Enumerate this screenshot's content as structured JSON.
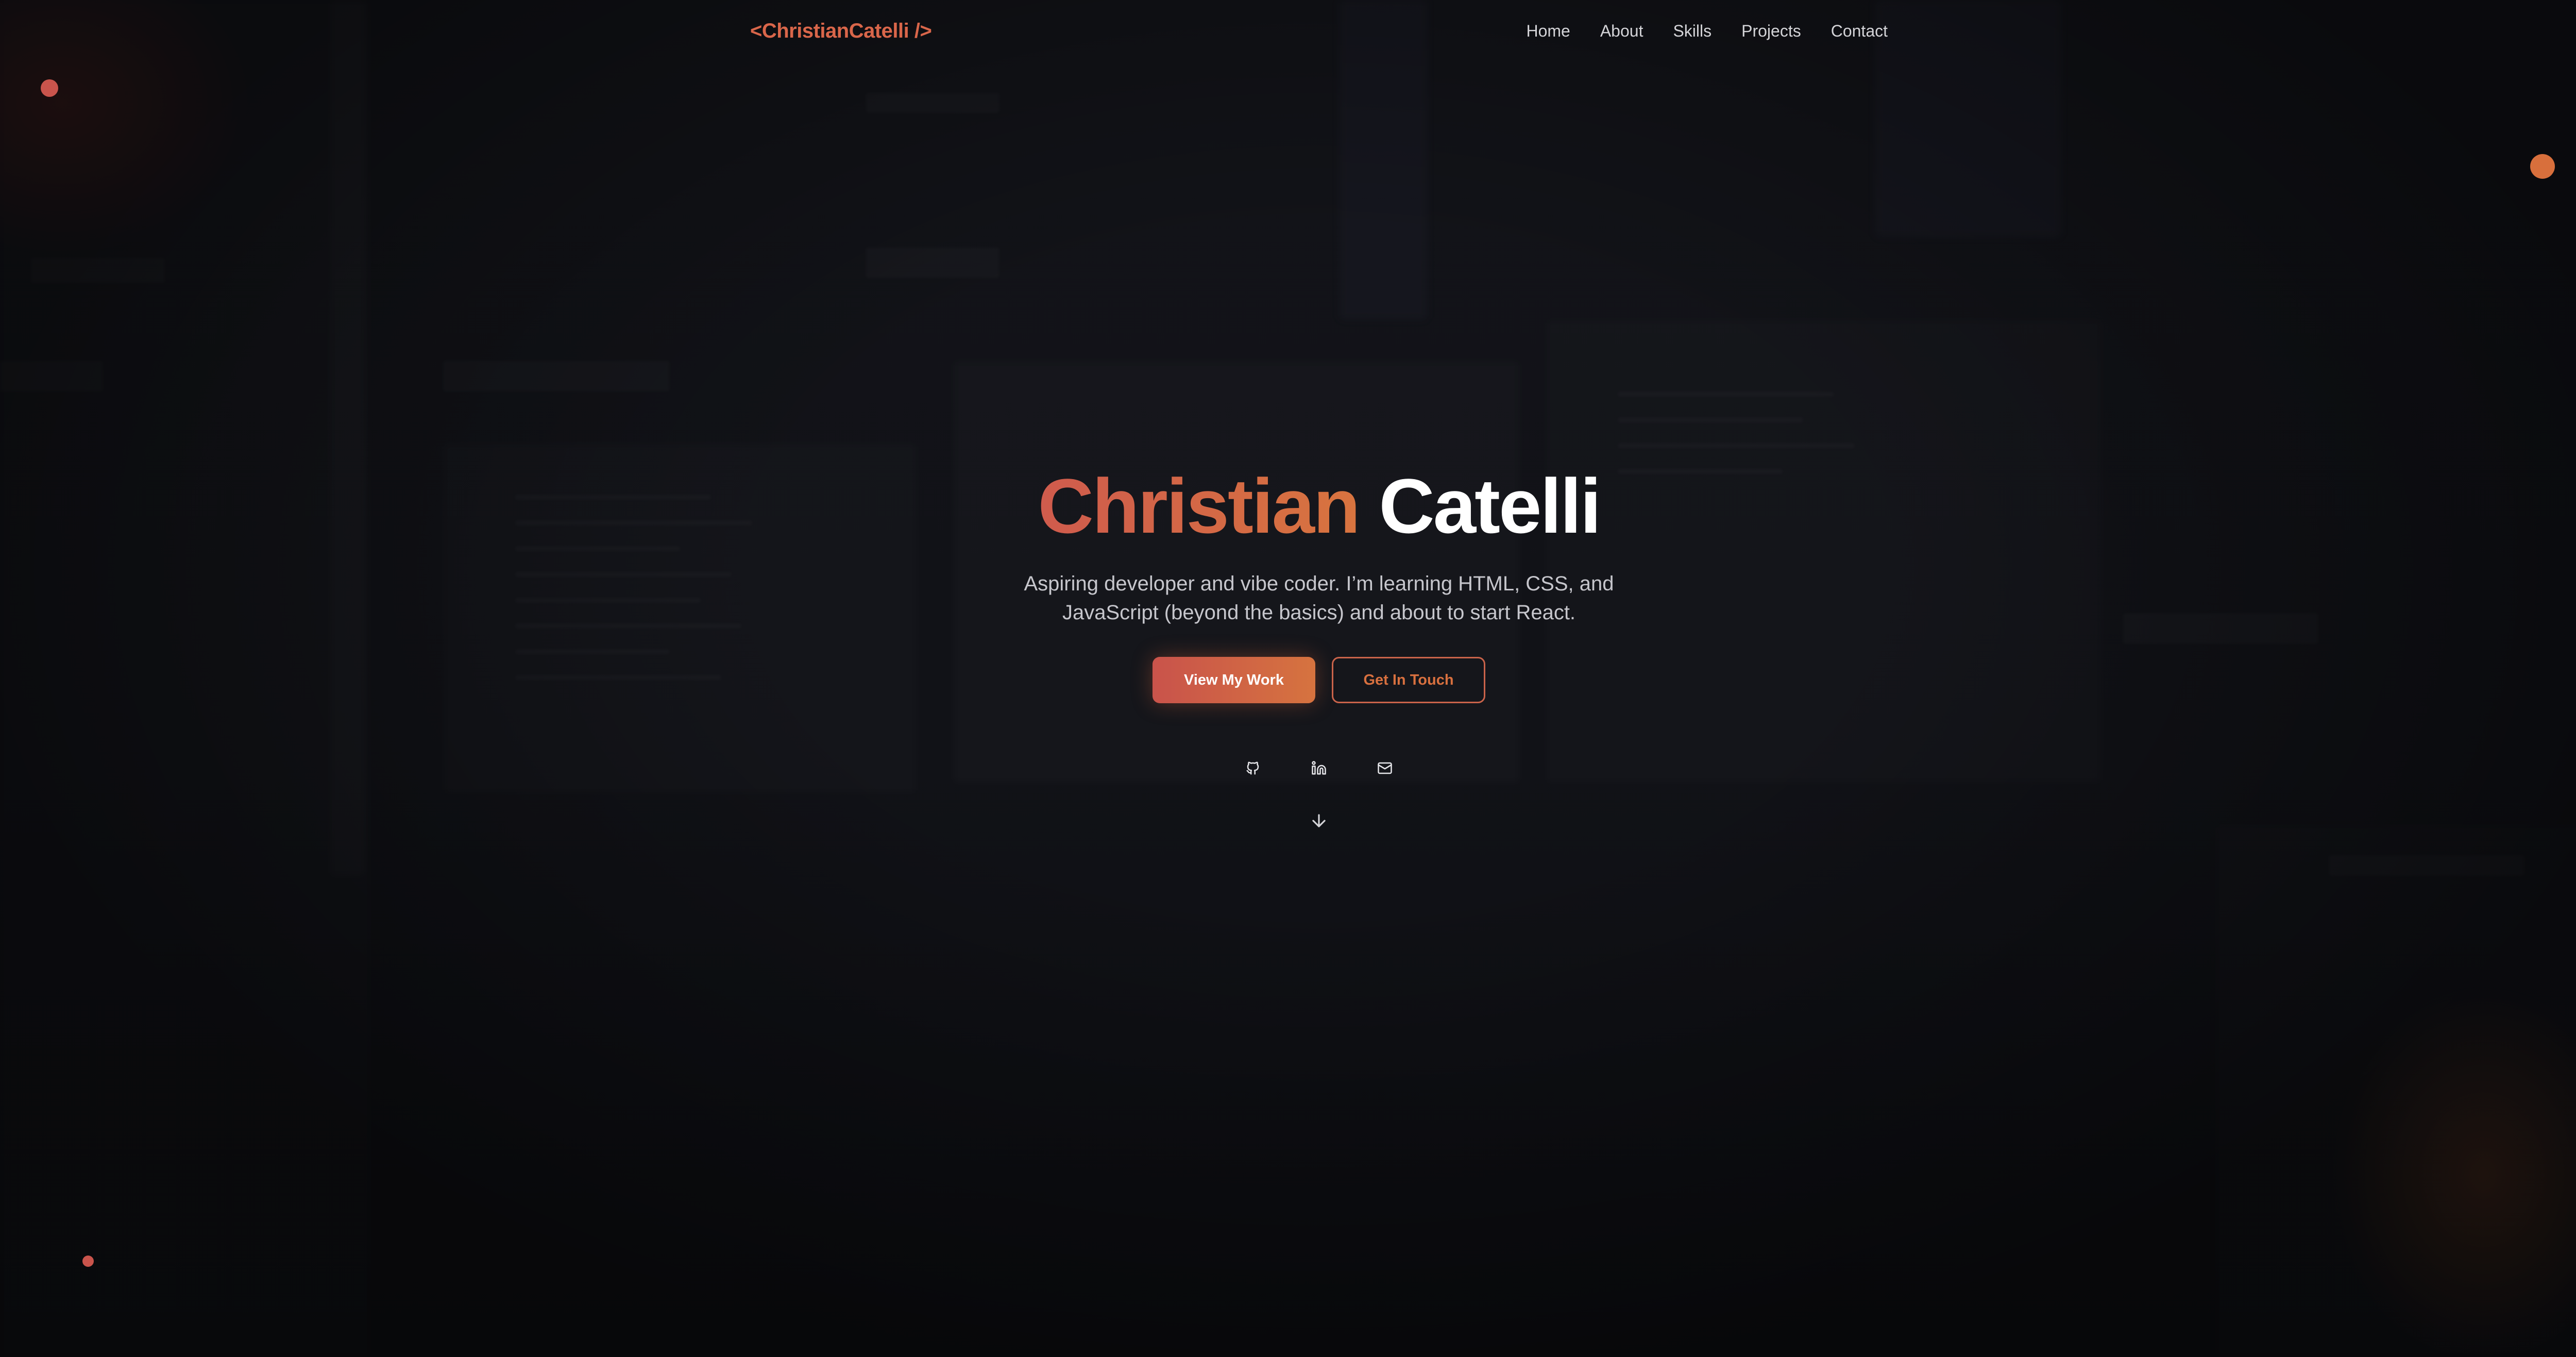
{
  "nav": {
    "logo": "<ChristianCatelli />",
    "items": [
      {
        "label": "Home"
      },
      {
        "label": "About"
      },
      {
        "label": "Skills"
      },
      {
        "label": "Projects"
      },
      {
        "label": "Contact"
      }
    ]
  },
  "hero": {
    "first_name": "Christian",
    "last_name": "Catelli",
    "tagline": "Aspiring developer and vibe coder. I’m learning HTML, CSS, and JavaScript (beyond the basics) and about to start React.",
    "primary_button": "View My Work",
    "secondary_button": "Get In Touch",
    "socials": [
      {
        "icon": "github-icon"
      },
      {
        "icon": "linkedin-icon"
      },
      {
        "icon": "mail-icon"
      }
    ],
    "scroll_icon": "arrow-down-icon"
  },
  "colors": {
    "background": "#111217",
    "accent_start": "#cf5b4d",
    "accent_end": "#d8743f",
    "text": "#ffffff",
    "muted_text": "#c6c6cc"
  }
}
